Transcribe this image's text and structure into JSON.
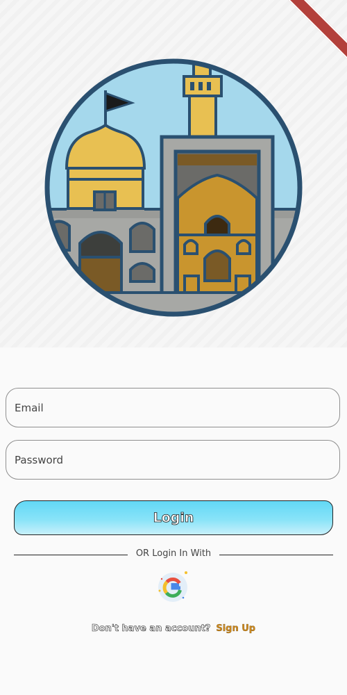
{
  "app": {
    "logo": "shrine-dome-minaret-illustration",
    "debug_banner": "debug-ribbon"
  },
  "form": {
    "email_placeholder": "Email",
    "password_placeholder": "Password",
    "login_label": "Login"
  },
  "social": {
    "divider_text": "OR Login In With",
    "google_icon": "google-icon"
  },
  "signup": {
    "question": "Don't have an account?",
    "link_label": "Sign Up"
  },
  "colors": {
    "button_gradient_top": "#62d8f6",
    "button_gradient_bottom": "#c8f0fb",
    "signup_link": "#cf8a1e",
    "sky": "#a5d8ec",
    "outline": "#2a5070",
    "gold": "#e8c052"
  }
}
